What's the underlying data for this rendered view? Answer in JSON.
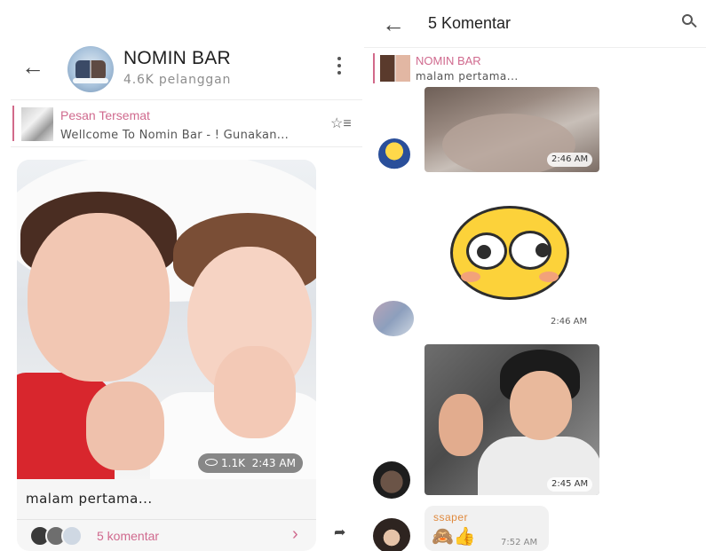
{
  "left": {
    "channel_name": "NOMIN BAR",
    "subscribers": "4.6K pelanggan",
    "pinned": {
      "title": "Pesan Tersemat",
      "text": "Wellcome To Nomin Bar - ! Gunakan..."
    },
    "post": {
      "views": "1.1K",
      "time": "2:43 AM",
      "caption": "malam pertama...",
      "comments_label": "5 komentar"
    }
  },
  "right": {
    "title": "5 Komentar",
    "ref": {
      "title": "NOMIN BAR",
      "text": "malam pertama..."
    },
    "messages": [
      {
        "time": "2:46 AM"
      },
      {
        "time": "2:46 AM"
      },
      {
        "time": "2:45 AM"
      }
    ],
    "bubble": {
      "name": "ssaper",
      "emojis": "🙈👍",
      "time": "7:52 AM"
    }
  },
  "icons": {
    "back": "←",
    "chevron": "›",
    "share": "➦",
    "pin_list": "☆≡"
  },
  "colors": {
    "accent": "#d06a8e",
    "name_orange": "#e08a3e"
  }
}
